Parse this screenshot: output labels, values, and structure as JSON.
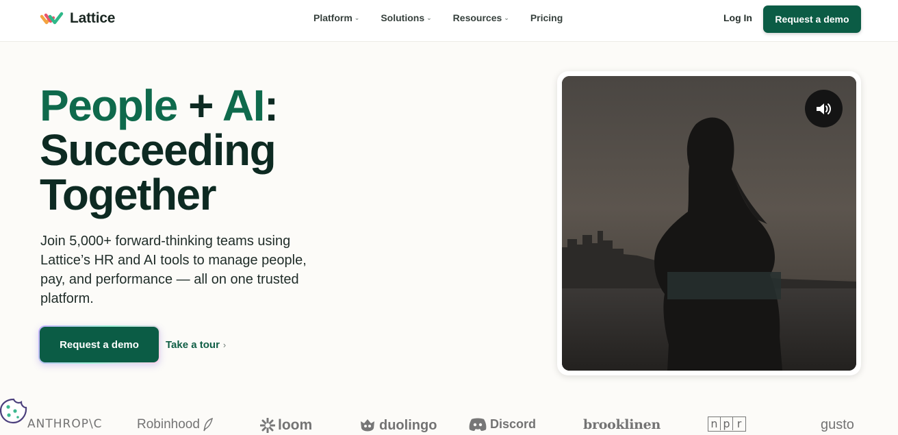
{
  "header": {
    "logo_text": "Lattice",
    "nav": [
      {
        "label": "Platform",
        "has_dropdown": true
      },
      {
        "label": "Solutions",
        "has_dropdown": true
      },
      {
        "label": "Resources",
        "has_dropdown": true
      },
      {
        "label": "Pricing",
        "has_dropdown": false
      }
    ],
    "login_label": "Log In",
    "demo_label": "Request a demo"
  },
  "hero": {
    "headline_part1": "People",
    "headline_plus": " + ",
    "headline_part2": "AI",
    "headline_colon": ":",
    "headline_line2": "Succeeding",
    "headline_line3": "Together",
    "subtext": "Join 5,000+ forward-thinking teams using Lattice’s HR and AI tools to manage people, pay, and performance — all on one trusted platform.",
    "cta_primary": "Request a demo",
    "cta_secondary": "Take a tour",
    "cta_secondary_chevron": "›"
  },
  "video": {
    "sound_icon": "speaker-icon"
  },
  "logo_strip": {
    "anthropic": "ANTHROP\\C",
    "robinhood": "Robinhood",
    "loom": "loom",
    "duolingo": "duolingo",
    "discord": "Discord",
    "brooklinen": "brooklinen",
    "npr": [
      "n",
      "p",
      "r"
    ],
    "gusto": "gusto"
  },
  "colors": {
    "brand_green": "#0b5c45",
    "accent_green": "#0f6a4c",
    "text_dark": "#0d2a22",
    "background": "#fcfbf8"
  }
}
